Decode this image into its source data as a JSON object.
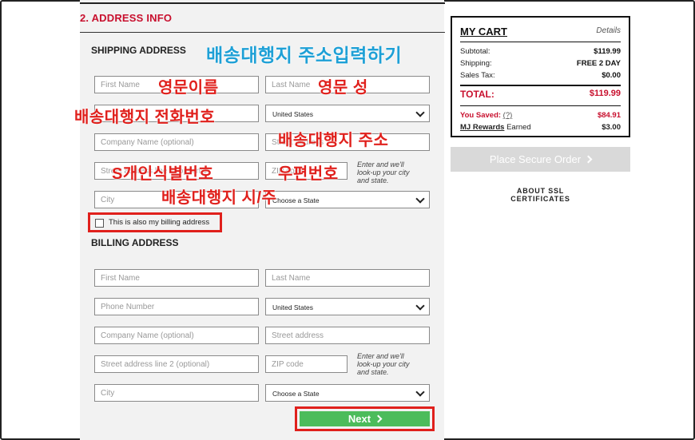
{
  "section": {
    "title": "2. ADDRESS INFO"
  },
  "shipping": {
    "title": "SHIPPING ADDRESS",
    "first_name": "First Name",
    "last_name": "Last Name",
    "phone": "",
    "country": "United States",
    "company": "Company Name (optional)",
    "street": "Street address",
    "street2": "Street address line 2 (optional)",
    "zip": "ZIP code",
    "zip_hint": "Enter and we'll look-up your city and state.",
    "city": "City",
    "state": "Choose a State",
    "billing_same_label": "This is also my billing address"
  },
  "billing": {
    "title": "BILLING ADDRESS",
    "first_name": "First Name",
    "last_name": "Last Name",
    "phone": "Phone Number",
    "country": "United States",
    "company": "Company Name (optional)",
    "street": "Street address",
    "street2": "Street address line 2 (optional)",
    "zip": "ZIP code",
    "zip_hint": "Enter and we'll look-up your city and state.",
    "city": "City",
    "state": "Choose a State"
  },
  "next_label": "Next",
  "annotations": {
    "title": "배송대행지 주소입력하기",
    "first_name": "영문이름",
    "last_name": "영문 성",
    "phone": "배송대행지 전화번호",
    "address": "배송대행지 주소",
    "customs_id": "S개인식별번호",
    "zip": "우편번호",
    "city_state": "배송대행지 시/주"
  },
  "cart": {
    "title": "MY CART",
    "details_label": "Details",
    "subtotal_label": "Subtotal:",
    "subtotal": "$119.99",
    "shipping_label": "Shipping:",
    "shipping": "FREE 2 DAY",
    "tax_label": "Sales Tax:",
    "tax": "$0.00",
    "total_label": "TOTAL:",
    "total": "$119.99",
    "saved_label": "You Saved:",
    "saved_help": "(?)",
    "saved": "$84.91",
    "rewards_label": "MJ Rewards",
    "rewards_suffix": "Earned",
    "rewards": "$3.00"
  },
  "place_order_label": "Place Secure Order",
  "ssl_line1": "ABOUT SSL",
  "ssl_line2": "CERTIFICATES",
  "colors": {
    "brand_red": "#c8102e",
    "annotation_red": "#e0201c",
    "annotation_blue": "#1ea0d6",
    "next_green": "#4cbc5b"
  }
}
